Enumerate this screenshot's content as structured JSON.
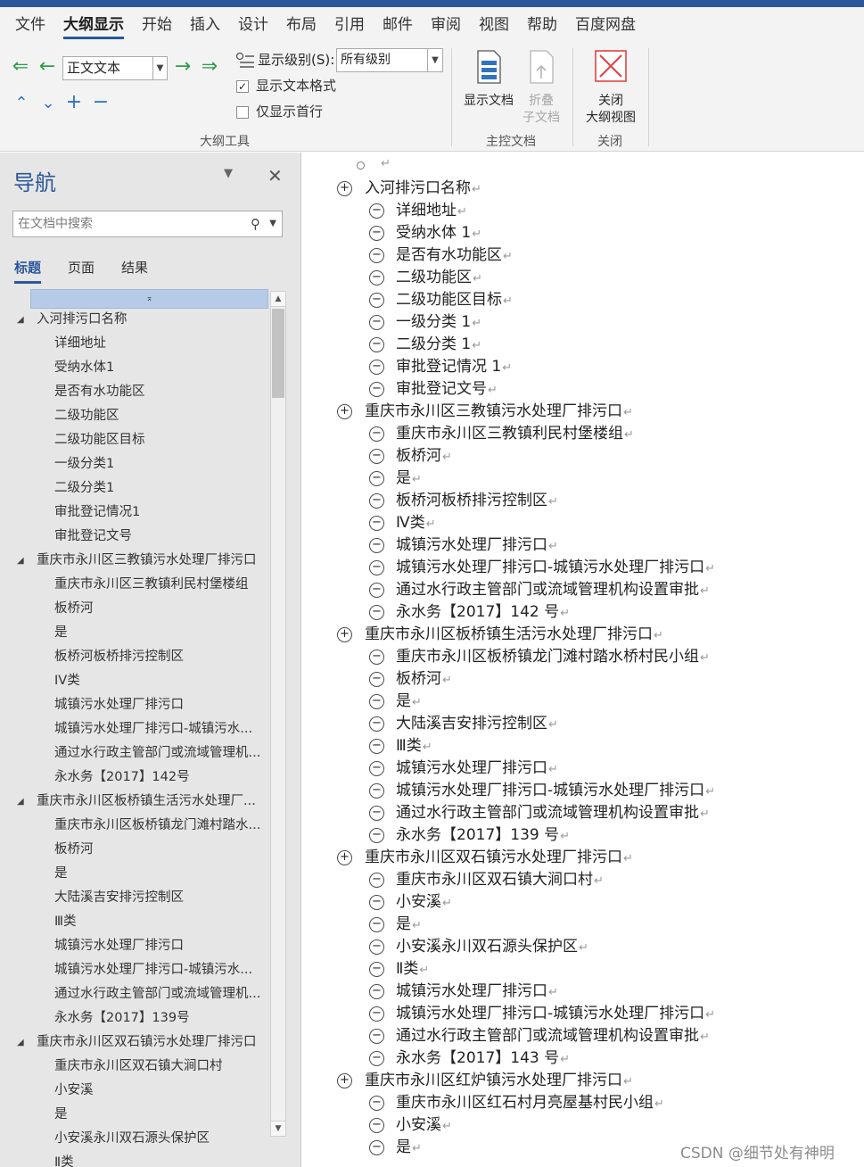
{
  "menu": {
    "tabs": [
      "文件",
      "大纲显示",
      "开始",
      "插入",
      "设计",
      "布局",
      "引用",
      "邮件",
      "审阅",
      "视图",
      "帮助",
      "百度网盘"
    ],
    "active": "大纲显示"
  },
  "ribbon": {
    "style_value": "正文文本",
    "level_label": "显示级别(S):",
    "level_value": "所有级别",
    "show_formatting_label": "显示文本格式",
    "show_formatting_checked": true,
    "first_line_only_label": "仅显示首行",
    "first_line_only_checked": false,
    "outline_tools_label": "大纲工具",
    "show_document_label": "显示文档",
    "collapse_sub_line1": "折叠",
    "collapse_sub_line2": "子文档",
    "master_document_label": "主控文档",
    "close_line1": "关闭",
    "close_line2": "大纲视图",
    "close_group_label": "关闭"
  },
  "nav": {
    "title": "导航",
    "search_placeholder": "在文档中搜索",
    "tabs": [
      "标题",
      "页面",
      "结果"
    ],
    "active_tab": "标题",
    "items": [
      {
        "level": 1,
        "text": "入河排污口名称"
      },
      {
        "level": 2,
        "text": "详细地址"
      },
      {
        "level": 2,
        "text": "受纳水体1"
      },
      {
        "level": 2,
        "text": "是否有水功能区"
      },
      {
        "level": 2,
        "text": "二级功能区"
      },
      {
        "level": 2,
        "text": "二级功能区目标"
      },
      {
        "level": 2,
        "text": "一级分类1"
      },
      {
        "level": 2,
        "text": "二级分类1"
      },
      {
        "level": 2,
        "text": "审批登记情况1"
      },
      {
        "level": 2,
        "text": "审批登记文号"
      },
      {
        "level": 1,
        "text": "重庆市永川区三教镇污水处理厂排污口"
      },
      {
        "level": 2,
        "text": "重庆市永川区三教镇利民村堡楼组"
      },
      {
        "level": 2,
        "text": "板桥河"
      },
      {
        "level": 2,
        "text": "是"
      },
      {
        "level": 2,
        "text": "板桥河板桥排污控制区"
      },
      {
        "level": 2,
        "text": "IV类"
      },
      {
        "level": 2,
        "text": "城镇污水处理厂排污口"
      },
      {
        "level": 2,
        "text": "城镇污水处理厂排污口-城镇污水..."
      },
      {
        "level": 2,
        "text": "通过水行政主管部门或流域管理机..."
      },
      {
        "level": 2,
        "text": "永水务【2017】142号"
      },
      {
        "level": 1,
        "text": "重庆市永川区板桥镇生活污水处理厂..."
      },
      {
        "level": 2,
        "text": "重庆市永川区板桥镇龙门滩村踏水..."
      },
      {
        "level": 2,
        "text": "板桥河"
      },
      {
        "level": 2,
        "text": "是"
      },
      {
        "level": 2,
        "text": "大陆溪吉安排污控制区"
      },
      {
        "level": 2,
        "text": "Ⅲ类"
      },
      {
        "level": 2,
        "text": "城镇污水处理厂排污口"
      },
      {
        "level": 2,
        "text": "城镇污水处理厂排污口-城镇污水..."
      },
      {
        "level": 2,
        "text": "通过水行政主管部门或流域管理机..."
      },
      {
        "level": 2,
        "text": "永水务【2017】139号"
      },
      {
        "level": 1,
        "text": "重庆市永川区双石镇污水处理厂排污口"
      },
      {
        "level": 2,
        "text": "重庆市永川区双石镇大涧口村"
      },
      {
        "level": 2,
        "text": "小安溪"
      },
      {
        "level": 2,
        "text": "是"
      },
      {
        "level": 2,
        "text": "小安溪永川双石源头保护区"
      },
      {
        "level": 2,
        "text": "Ⅱ类"
      }
    ]
  },
  "document": {
    "lines": [
      {
        "level": 1,
        "text": "入河排污口名称"
      },
      {
        "level": 2,
        "text": "详细地址"
      },
      {
        "level": 2,
        "text": "受纳水体 1"
      },
      {
        "level": 2,
        "text": "是否有水功能区"
      },
      {
        "level": 2,
        "text": "二级功能区"
      },
      {
        "level": 2,
        "text": "二级功能区目标"
      },
      {
        "level": 2,
        "text": "一级分类 1"
      },
      {
        "level": 2,
        "text": "二级分类 1"
      },
      {
        "level": 2,
        "text": "审批登记情况 1"
      },
      {
        "level": 2,
        "text": "审批登记文号"
      },
      {
        "level": 1,
        "text": "重庆市永川区三教镇污水处理厂排污口"
      },
      {
        "level": 2,
        "text": "重庆市永川区三教镇利民村堡楼组"
      },
      {
        "level": 2,
        "text": "板桥河"
      },
      {
        "level": 2,
        "text": "是"
      },
      {
        "level": 2,
        "text": "板桥河板桥排污控制区"
      },
      {
        "level": 2,
        "text": "Ⅳ类"
      },
      {
        "level": 2,
        "text": "城镇污水处理厂排污口"
      },
      {
        "level": 2,
        "text": "城镇污水处理厂排污口-城镇污水处理厂排污口"
      },
      {
        "level": 2,
        "text": "通过水行政主管部门或流域管理机构设置审批"
      },
      {
        "level": 2,
        "text": "永水务【2017】142 号"
      },
      {
        "level": 1,
        "text": "重庆市永川区板桥镇生活污水处理厂排污口"
      },
      {
        "level": 2,
        "text": "重庆市永川区板桥镇龙门滩村踏水桥村民小组"
      },
      {
        "level": 2,
        "text": "板桥河"
      },
      {
        "level": 2,
        "text": "是"
      },
      {
        "level": 2,
        "text": "大陆溪吉安排污控制区"
      },
      {
        "level": 2,
        "text": "Ⅲ类"
      },
      {
        "level": 2,
        "text": "城镇污水处理厂排污口"
      },
      {
        "level": 2,
        "text": "城镇污水处理厂排污口-城镇污水处理厂排污口"
      },
      {
        "level": 2,
        "text": "通过水行政主管部门或流域管理机构设置审批"
      },
      {
        "level": 2,
        "text": "永水务【2017】139 号"
      },
      {
        "level": 1,
        "text": "重庆市永川区双石镇污水处理厂排污口"
      },
      {
        "level": 2,
        "text": "重庆市永川区双石镇大涧口村"
      },
      {
        "level": 2,
        "text": "小安溪"
      },
      {
        "level": 2,
        "text": "是"
      },
      {
        "level": 2,
        "text": "小安溪永川双石源头保护区"
      },
      {
        "level": 2,
        "text": "Ⅱ类"
      },
      {
        "level": 2,
        "text": "城镇污水处理厂排污口"
      },
      {
        "level": 2,
        "text": "城镇污水处理厂排污口-城镇污水处理厂排污口"
      },
      {
        "level": 2,
        "text": "通过水行政主管部门或流域管理机构设置审批"
      },
      {
        "level": 2,
        "text": "永水务【2017】143 号"
      },
      {
        "level": 1,
        "text": "重庆市永川区红炉镇污水处理厂排污口"
      },
      {
        "level": 2,
        "text": "重庆市永川区红石村月亮屋基村民小组"
      },
      {
        "level": 2,
        "text": "小安溪"
      },
      {
        "level": 2,
        "text": "是"
      }
    ]
  },
  "watermark": "CSDN @细节处有神明",
  "colors": {
    "accent": "#2b579a",
    "arrow_green": "#2e9e4a",
    "arrow_blue": "#2f74c0",
    "close_red": "#e04343"
  }
}
